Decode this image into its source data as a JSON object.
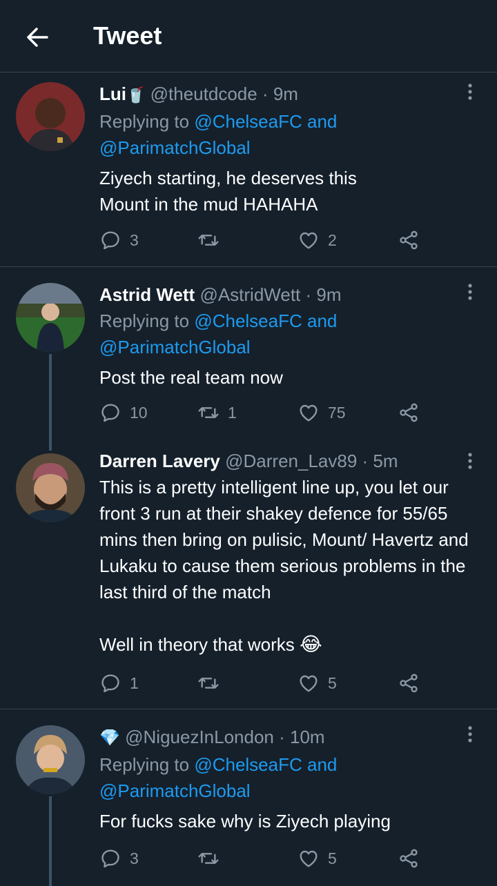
{
  "header": {
    "title": "Tweet"
  },
  "tweets": [
    {
      "name": "Lui",
      "name_emoji": "🥤",
      "handle": "@theutdcode",
      "time": "9m",
      "replying_prefix": "Replying to ",
      "mention_1": "@ChelseaFC",
      "mention_joiner": " and",
      "mention_2": "@ParimatchGlobal",
      "text": "Ziyech starting, he deserves this\nMount in the mud HAHAHA",
      "replies": "3",
      "retweets": "",
      "likes": "2"
    },
    {
      "name": "Astrid Wett",
      "handle": "@AstridWett",
      "time": "9m",
      "replying_prefix": "Replying to ",
      "mention_1": "@ChelseaFC",
      "mention_joiner": " and",
      "mention_2": "@ParimatchGlobal",
      "text": "Post the real team now",
      "replies": "10",
      "retweets": "1",
      "likes": "75"
    },
    {
      "name": "Darren Lavery",
      "handle": "@Darren_Lav89",
      "time": "5m",
      "text": "This is a pretty intelligent line up, you let our front 3 run at their shakey defence for 55/65 mins then bring on pulisic, Mount/ Havertz and Lukaku to cause them serious problems in the last third of the match\n\nWell in theory that works",
      "text_emoji": "😂",
      "replies": "1",
      "retweets": "",
      "likes": "5"
    },
    {
      "name": "💎",
      "handle": "@NiguezInLondon",
      "time": "10m",
      "replying_prefix": "Replying to ",
      "mention_1": "@ChelseaFC",
      "mention_joiner": " and",
      "mention_2": "@ParimatchGlobal",
      "text": "For fucks sake why is Ziyech playing",
      "replies": "3",
      "retweets": "",
      "likes": "5"
    }
  ],
  "separator_dot": " · ",
  "colors": {
    "background": "#15202b",
    "secondary": "#8b98a5",
    "link": "#1d9bf0",
    "border": "#38444d"
  }
}
